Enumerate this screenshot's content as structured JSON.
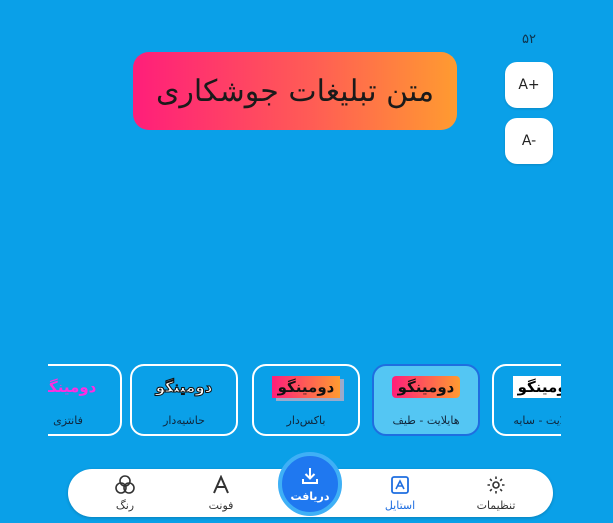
{
  "font_size": {
    "value": "۵۲",
    "increase_label": "A+",
    "decrease_label": "A-"
  },
  "banner": {
    "text": "متن تبلیغات جوشکاری"
  },
  "styles": [
    {
      "preview": "دومینگو",
      "caption": "فانتزی"
    },
    {
      "preview": "دومینگو",
      "caption": "حاشیه‌دار"
    },
    {
      "preview": "دومینگو",
      "caption": "باکس‌دار"
    },
    {
      "preview": "دومینگو",
      "caption": "هایلایت - طیف"
    },
    {
      "preview": "دومینگو",
      "caption": "هایلایت - سایه"
    }
  ],
  "selected_style_index": 3,
  "nav": {
    "color": "رنگ",
    "font": "فونت",
    "download": "دریافت",
    "style": "استایل",
    "settings": "تنظیمات"
  },
  "colors": {
    "background": "#0aa0e8",
    "accent": "#1f78f0",
    "banner_start": "#ff1e7a",
    "banner_end": "#ff9b30"
  }
}
